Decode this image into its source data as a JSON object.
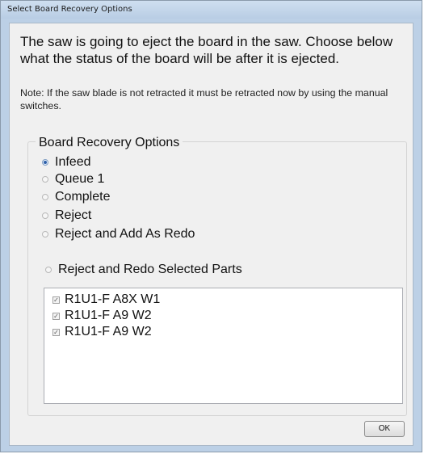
{
  "window": {
    "title": "Select Board Recovery Options"
  },
  "intro_text": "The saw is going to eject the board in the saw.  Choose below what the status of the board will be after it is ejected.",
  "note_text": "Note:  If the saw blade is not retracted it must be retracted now by using the manual switches.",
  "group": {
    "title": "Board Recovery Options",
    "options": [
      {
        "label": "Infeed",
        "checked": true
      },
      {
        "label": "Queue 1",
        "checked": false
      },
      {
        "label": "Complete",
        "checked": false
      },
      {
        "label": "Reject",
        "checked": false
      },
      {
        "label": "Reject and Add As Redo",
        "checked": false
      },
      {
        "label": "Reject and Redo Selected Parts",
        "checked": false
      }
    ]
  },
  "parts": [
    {
      "label": "R1U1-F A8X W1",
      "checked": true
    },
    {
      "label": "R1U1-F A9 W2",
      "checked": true
    },
    {
      "label": "R1U1-F A9 W2",
      "checked": true
    }
  ],
  "ok_label": "OK"
}
